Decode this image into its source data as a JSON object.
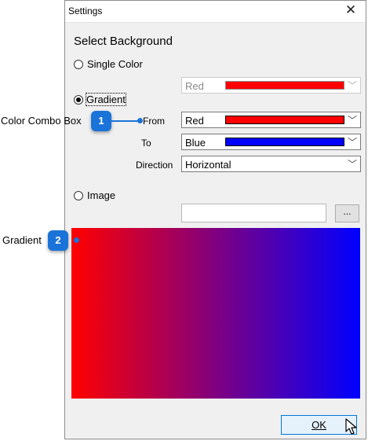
{
  "window": {
    "title": "Settings",
    "close_glyph": "✕"
  },
  "heading": "Select Background",
  "options": {
    "single_color": {
      "label": "Single Color",
      "selected": false,
      "color_name": "Red",
      "color": "#ff0000"
    },
    "gradient": {
      "label": "Gradient",
      "selected": true,
      "from_label": "From",
      "from_name": "Red",
      "from_color": "#ff0000",
      "to_label": "To",
      "to_name": "Blue",
      "to_color": "#0000ff",
      "direction_label": "Direction",
      "direction_value": "Horizontal"
    },
    "image": {
      "label": "Image",
      "selected": false,
      "path_value": "",
      "browse_label": "..."
    }
  },
  "preview": {
    "start_color": "#ff0000",
    "end_color": "#0000ff"
  },
  "ok_label": "OK",
  "callouts": [
    {
      "number": "1",
      "text": "Color Combo Box"
    },
    {
      "number": "2",
      "text": "Gradient"
    }
  ],
  "colors": {
    "accent": "#1a73d8",
    "dialog_bg": "#f0f0f0",
    "ok_border": "#0078d7"
  }
}
